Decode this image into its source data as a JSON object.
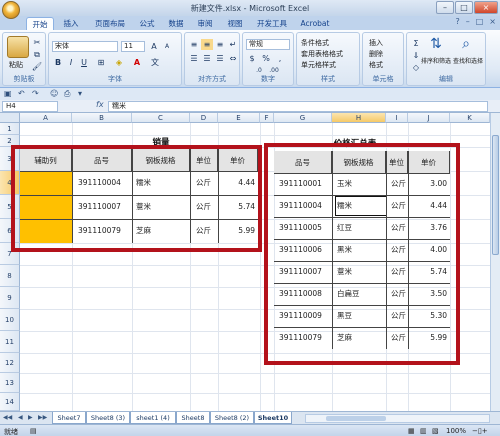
{
  "window": {
    "title": "新建文件.xlsx - Microsoft Excel"
  },
  "tabs": [
    "开始",
    "插入",
    "页面布局",
    "公式",
    "数据",
    "审阅",
    "视图",
    "开发工具",
    "Acrobat"
  ],
  "ribbon": {
    "paste_label": "粘贴",
    "clipboard_label": "剪贴板",
    "font_name": "宋体",
    "font_size": "11",
    "font_group": "字体",
    "align_group": "对齐方式",
    "number_format": "常规",
    "number_group": "数字",
    "cond_format": "条件格式",
    "table_format": "套用表格格式",
    "cell_style": "单元格样式",
    "style_group": "样式",
    "insert": "插入",
    "delete": "删除",
    "format": "格式",
    "cells_group": "单元格",
    "sort_filter": "排序和筛选",
    "find_select": "查找和选择",
    "edit_group": "编辑"
  },
  "formula_bar": {
    "name_box": "H4",
    "fx": "fx",
    "content": "糯米"
  },
  "columns": [
    "A",
    "B",
    "C",
    "D",
    "E",
    "F",
    "G",
    "H",
    "I",
    "J",
    "K"
  ],
  "rows": [
    "1",
    "2",
    "3",
    "4",
    "5",
    "6",
    "7",
    "8",
    "9",
    "10",
    "11",
    "12",
    "13",
    "14",
    "15"
  ],
  "left_table": {
    "title": "销量",
    "headers": [
      "辅助列",
      "品号",
      "钢板规格",
      "单位",
      "单价"
    ],
    "rows": [
      [
        "",
        "391110004",
        "糯米",
        "公斤",
        "4.44"
      ],
      [
        "",
        "391110007",
        "薏米",
        "公斤",
        "5.74"
      ],
      [
        "",
        "391110079",
        "芝麻",
        "公斤",
        "5.99"
      ]
    ]
  },
  "right_table": {
    "title": "价格汇总表",
    "headers": [
      "品号",
      "钢板规格",
      "单位",
      "单价"
    ],
    "rows": [
      [
        "391110001",
        "玉米",
        "公斤",
        "3.00"
      ],
      [
        "391110004",
        "糯米",
        "公斤",
        "4.44"
      ],
      [
        "391110005",
        "红豆",
        "公斤",
        "3.76"
      ],
      [
        "391110006",
        "黑米",
        "公斤",
        "4.00"
      ],
      [
        "391110007",
        "薏米",
        "公斤",
        "5.74"
      ],
      [
        "391110008",
        "白扁豆",
        "公斤",
        "3.50"
      ],
      [
        "391110009",
        "黑豆",
        "公斤",
        "5.30"
      ],
      [
        "391110079",
        "芝麻",
        "公斤",
        "5.99"
      ]
    ]
  },
  "sheet_tabs": [
    "Sheet7",
    "Sheet8 (3)",
    "sheet1 (4)",
    "Sheet8",
    "Sheet8 (2)",
    "Sheet10"
  ],
  "status": {
    "ready": "就绪",
    "zoom": "100%"
  },
  "colors": {
    "highlight_border": "#b3121b",
    "helper_fill": "#ffc000",
    "header_fill": "#e4e4e4"
  }
}
